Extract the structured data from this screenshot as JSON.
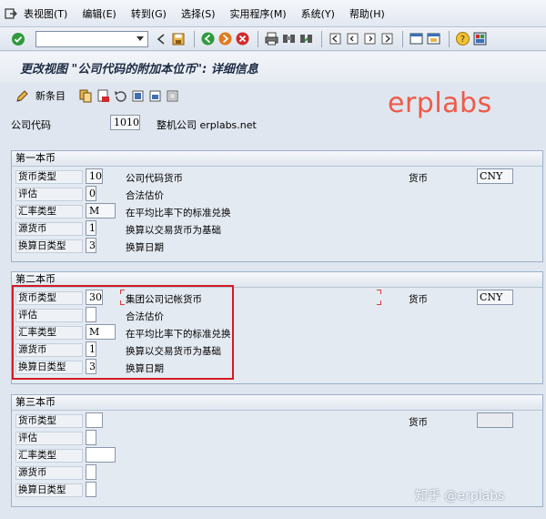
{
  "menubar": {
    "items": [
      "表视图(T)",
      "编辑(E)",
      "转到(G)",
      "选择(S)",
      "实用程序(M)",
      "系统(Y)",
      "帮助(H)"
    ]
  },
  "toolbar": {
    "command_value": "",
    "icons": [
      "enter-check-icon",
      "back-icon",
      "save-icon",
      "back-green-icon",
      "exit-icon",
      "cancel-icon",
      "print-icon",
      "find-icon",
      "find-next-icon",
      "first-page-icon",
      "prev-page-icon",
      "next-page-icon",
      "last-page-icon",
      "new-session-icon",
      "shortcut-icon",
      "help-icon",
      "layout-icon"
    ]
  },
  "title": "更改视图 \"公司代码的附加本位币\": 详细信息",
  "app_toolbar": {
    "new_entries_label": "新条目"
  },
  "watermark": "erplabs",
  "company_code": {
    "label": "公司代码",
    "value": "1010",
    "description": "整机公司 erplabs.net"
  },
  "groups": [
    {
      "title": "第一本币",
      "rows": [
        {
          "label": "货币类型",
          "value": "10",
          "desc": "公司代码货币"
        },
        {
          "label": "评估",
          "value": "0",
          "desc": "合法估价"
        },
        {
          "label": "汇率类型",
          "value": "M",
          "desc": "在平均比率下的标准兑换"
        },
        {
          "label": "源货币",
          "value": "1",
          "desc": "换算以交易货币为基础"
        },
        {
          "label": "换算日类型",
          "value": "3",
          "desc": "换算日期"
        }
      ],
      "currency_label": "货币",
      "currency_value": "CNY"
    },
    {
      "title": "第二本币",
      "rows": [
        {
          "label": "货币类型",
          "value": "30",
          "desc": "集团公司记帐货币"
        },
        {
          "label": "评估",
          "value": "",
          "desc": "合法估价"
        },
        {
          "label": "汇率类型",
          "value": "M",
          "desc": "在平均比率下的标准兑换"
        },
        {
          "label": "源货币",
          "value": "1",
          "desc": "换算以交易货币为基础"
        },
        {
          "label": "换算日类型",
          "value": "3",
          "desc": "换算日期"
        }
      ],
      "currency_label": "货币",
      "currency_value": "CNY"
    },
    {
      "title": "第三本币",
      "rows": [
        {
          "label": "货币类型",
          "value": "",
          "desc": ""
        },
        {
          "label": "评估",
          "value": "",
          "desc": ""
        },
        {
          "label": "汇率类型",
          "value": "",
          "desc": ""
        },
        {
          "label": "源货币",
          "value": "",
          "desc": ""
        },
        {
          "label": "换算日类型",
          "value": "",
          "desc": ""
        }
      ],
      "currency_label": "货币",
      "currency_value": ""
    }
  ],
  "footer_watermark": "知乎 @erplabs",
  "colors": {
    "highlight": "#d31b24",
    "watermark": "#ef5a4a"
  }
}
